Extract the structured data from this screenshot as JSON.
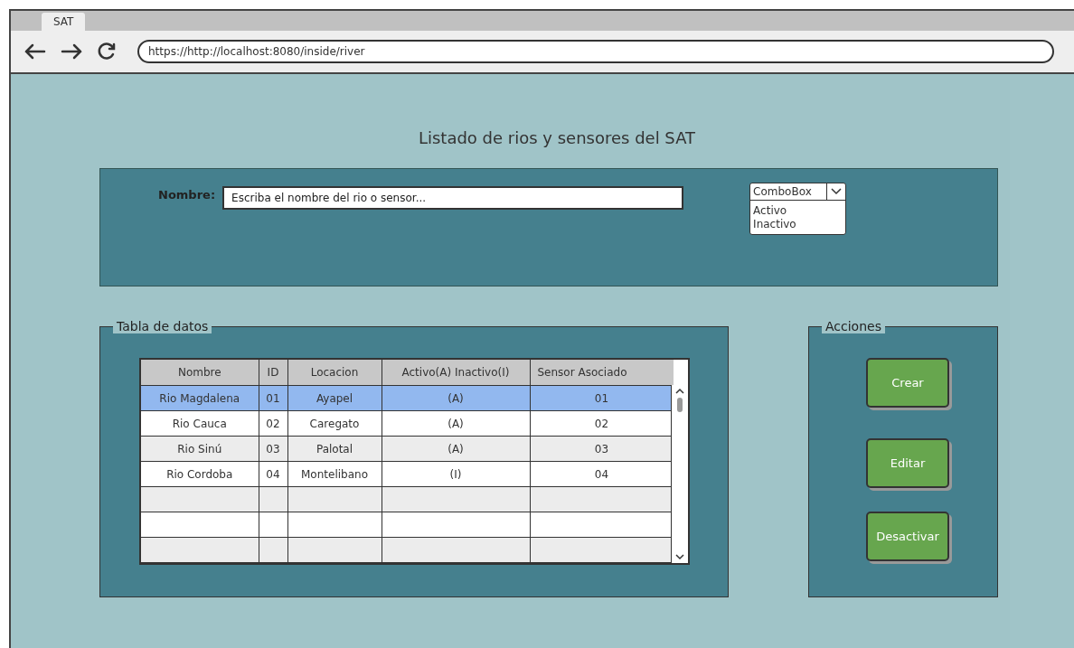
{
  "browser": {
    "tab": "SAT",
    "url": "https://http://localhost:8080/inside/river"
  },
  "page_title": "Listado de rios y sensores del SAT",
  "filter": {
    "label": "Nombre:",
    "placeholder": "Escriba el nombre del rio o sensor...",
    "combo": {
      "value": "ComboBox",
      "expanded": true,
      "options": [
        "Activo",
        "Inactivo"
      ]
    }
  },
  "table_panel": {
    "legend": "Tabla de datos",
    "columns": [
      "Nombre",
      "ID",
      "Locacion",
      "Activo(A) Inactivo(I)",
      "Sensor Asociado"
    ],
    "rows": [
      {
        "cells": [
          "Rio Magdalena",
          "01",
          "Ayapel",
          "(A)",
          "01"
        ],
        "selected": true
      },
      {
        "cells": [
          "Rio Cauca",
          "02",
          "Caregato",
          "(A)",
          "02"
        ],
        "selected": false
      },
      {
        "cells": [
          "Rio Sinú",
          "03",
          "Palotal",
          "(A)",
          "03"
        ],
        "selected": false
      },
      {
        "cells": [
          "Rio Cordoba",
          "04",
          "Montelibano",
          "(I)",
          "04"
        ],
        "selected": false
      }
    ]
  },
  "actions_panel": {
    "legend": "Acciones",
    "buttons": [
      "Crear",
      "Editar",
      "Desactivar"
    ]
  }
}
